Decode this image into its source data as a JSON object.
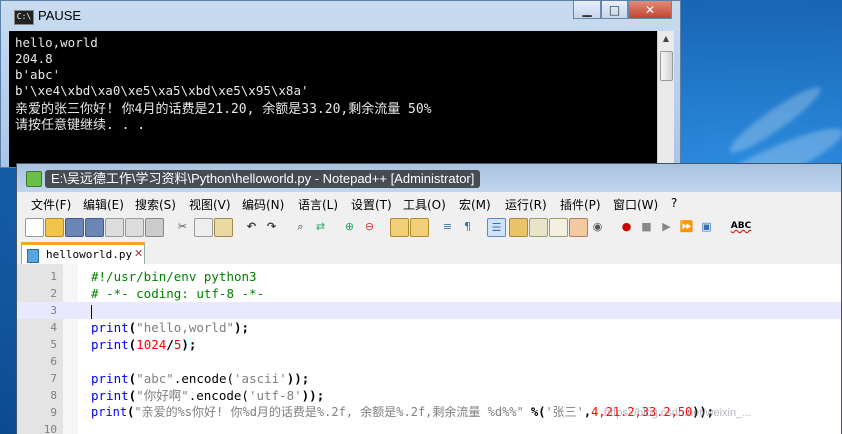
{
  "console": {
    "title": "PAUSE",
    "icon_text": "C:\\",
    "buttons": {
      "minimize": "▁",
      "maximize": "□",
      "close": "✕"
    },
    "lines": [
      "hello,world",
      "204.8",
      "b'abc'",
      "b'\\xe4\\xbd\\xa0\\xe5\\xa5\\xbd\\xe5\\x95\\x8a'",
      "亲爱的张三你好! 你4月的话费是21.20, 余额是33.20,剩余流量 50%",
      "请按任意键继续. . ."
    ]
  },
  "notepad": {
    "title": "E:\\吴远德工作\\学习资料\\Python\\helloworld.py - Notepad++ [Administrator]",
    "menu": [
      "文件(F)",
      "编辑(E)",
      "搜索(S)",
      "视图(V)",
      "编码(N)",
      "语言(L)",
      "设置(T)",
      "工具(O)",
      "宏(M)",
      "运行(R)",
      "插件(P)",
      "窗口(W)",
      "?"
    ],
    "tab": {
      "label": "helloworld.py",
      "close": "✕"
    },
    "line_numbers": [
      "1",
      "2",
      "3",
      "4",
      "5",
      "6",
      "7",
      "8",
      "9",
      "10"
    ],
    "code": {
      "l1": "#!/usr/bin/env python3",
      "l2": "# -*- coding: utf-8 -*-",
      "l4_kw": "print",
      "l4_p1": "(",
      "l4_s": "\"hello,world\"",
      "l4_p2": ");",
      "l5_kw": "print",
      "l5_p1": "(",
      "l5_n1": "1024",
      "l5_op": "/",
      "l5_n2": "5",
      "l5_p2": ");",
      "l7_kw": "print",
      "l7_p1": "(",
      "l7_s": "\"abc\"",
      "l7_m": ".encode(",
      "l7_s2": "'ascii'",
      "l7_p2": "));",
      "l8_kw": "print",
      "l8_p1": "(",
      "l8_s": "\"你好啊\"",
      "l8_m": ".encode(",
      "l8_s2": "'utf-8'",
      "l8_p2": "));",
      "l9_kw": "print",
      "l9_p1": "(",
      "l9_s": "\"亲爱的%s你好! 你%d月的话费是%.2f, 余额是%.2f,剩余流量 %d%%\"",
      "l9_op": " %",
      "l9_p3": "(",
      "l9_s2": "'张三'",
      "l9_rest1": ",",
      "l9_n": "4,21.2,33.2,50",
      "l9_p2": "));"
    }
  },
  "watermark": "https://blog.csdn.net/weixin_..."
}
